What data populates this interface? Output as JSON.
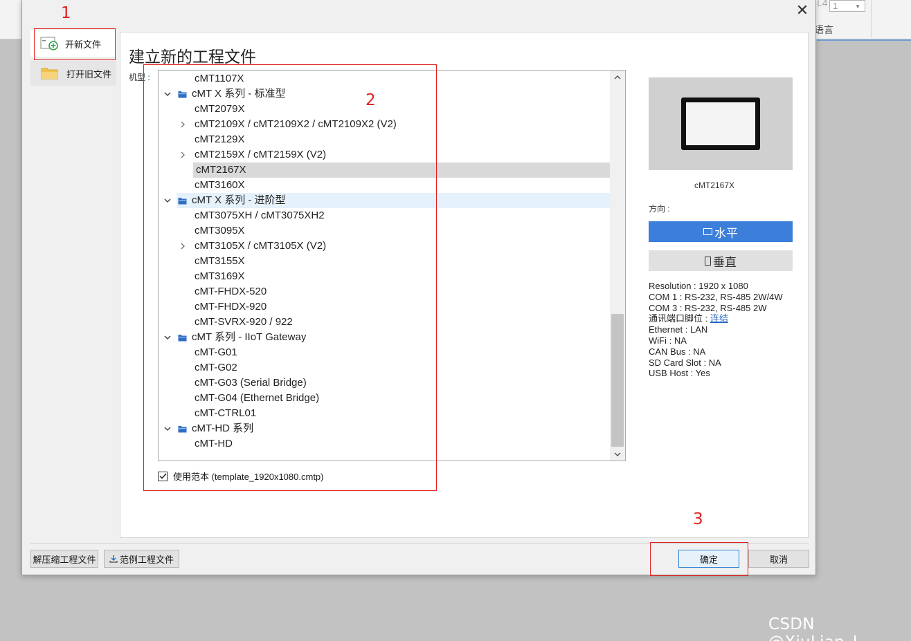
{
  "background": {
    "spin_label": "L4",
    "spin_value": "1",
    "language_label": "语言"
  },
  "watermark": "CSDN @XiuLian_L",
  "dialog": {
    "title": "建立新的工程文件",
    "nav": {
      "new_file": "开新文件",
      "open_file": "打开旧文件"
    },
    "model_label": "机型 :",
    "tree": [
      {
        "type": "model",
        "label": "cMT1107X"
      },
      {
        "type": "group",
        "label": "cMT X 系列 - 标准型"
      },
      {
        "type": "model",
        "label": "cMT2079X"
      },
      {
        "type": "model",
        "label": "cMT2109X / cMT2109X2 / cMT2109X2 (V2)",
        "expandable": true
      },
      {
        "type": "model",
        "label": "cMT2129X"
      },
      {
        "type": "model",
        "label": "cMT2159X / cMT2159X (V2)",
        "expandable": true
      },
      {
        "type": "model",
        "label": "cMT2167X",
        "selected": true
      },
      {
        "type": "model",
        "label": "cMT3160X"
      },
      {
        "type": "group",
        "label": "cMT X 系列 - 进阶型",
        "hover": true
      },
      {
        "type": "model",
        "label": "cMT3075XH / cMT3075XH2"
      },
      {
        "type": "model",
        "label": "cMT3095X"
      },
      {
        "type": "model",
        "label": "cMT3105X / cMT3105X (V2)",
        "expandable": true
      },
      {
        "type": "model",
        "label": "cMT3155X"
      },
      {
        "type": "model",
        "label": "cMT3169X"
      },
      {
        "type": "model",
        "label": "cMT-FHDX-520"
      },
      {
        "type": "model",
        "label": "cMT-FHDX-920"
      },
      {
        "type": "model",
        "label": "cMT-SVRX-920 / 922"
      },
      {
        "type": "group",
        "label": "cMT 系列 - IIoT Gateway"
      },
      {
        "type": "model",
        "label": "cMT-G01"
      },
      {
        "type": "model",
        "label": "cMT-G02"
      },
      {
        "type": "model",
        "label": "cMT-G03 (Serial Bridge)"
      },
      {
        "type": "model",
        "label": "cMT-G04 (Ethernet Bridge)"
      },
      {
        "type": "model",
        "label": "cMT-CTRL01"
      },
      {
        "type": "group",
        "label": "cMT-HD 系列"
      },
      {
        "type": "model",
        "label": "cMT-HD"
      }
    ],
    "use_template": {
      "label": "使用范本 (template_1920x1080.cmtp)",
      "checked": true
    },
    "preview": {
      "model_name": "cMT2167X",
      "orientation_label": "方向 :",
      "horizontal": "水平",
      "vertical": "垂直"
    },
    "specs": {
      "resolution": "Resolution : 1920 x 1080",
      "com1": "COM 1 : RS-232, RS-485 2W/4W",
      "com3": "COM 3 : RS-232, RS-485 2W",
      "pin_label": "通讯端口脚位 : ",
      "pin_link": "连结",
      "ethernet": "Ethernet : LAN",
      "wifi": "WiFi : NA",
      "can_bus": "CAN Bus : NA",
      "sd_card": "SD Card Slot : NA",
      "usb_host": "USB Host : Yes"
    },
    "footer": {
      "unzip": "解压缩工程文件",
      "example": "范例工程文件",
      "ok": "确定",
      "cancel": "取消"
    }
  },
  "annotations": {
    "n1": "1",
    "n2": "2",
    "n3": "3"
  },
  "colors": {
    "accent": "#3b7fdb",
    "annotation": "#e02020",
    "selection": "#d9d9d9",
    "hover": "#e5f1fb"
  }
}
